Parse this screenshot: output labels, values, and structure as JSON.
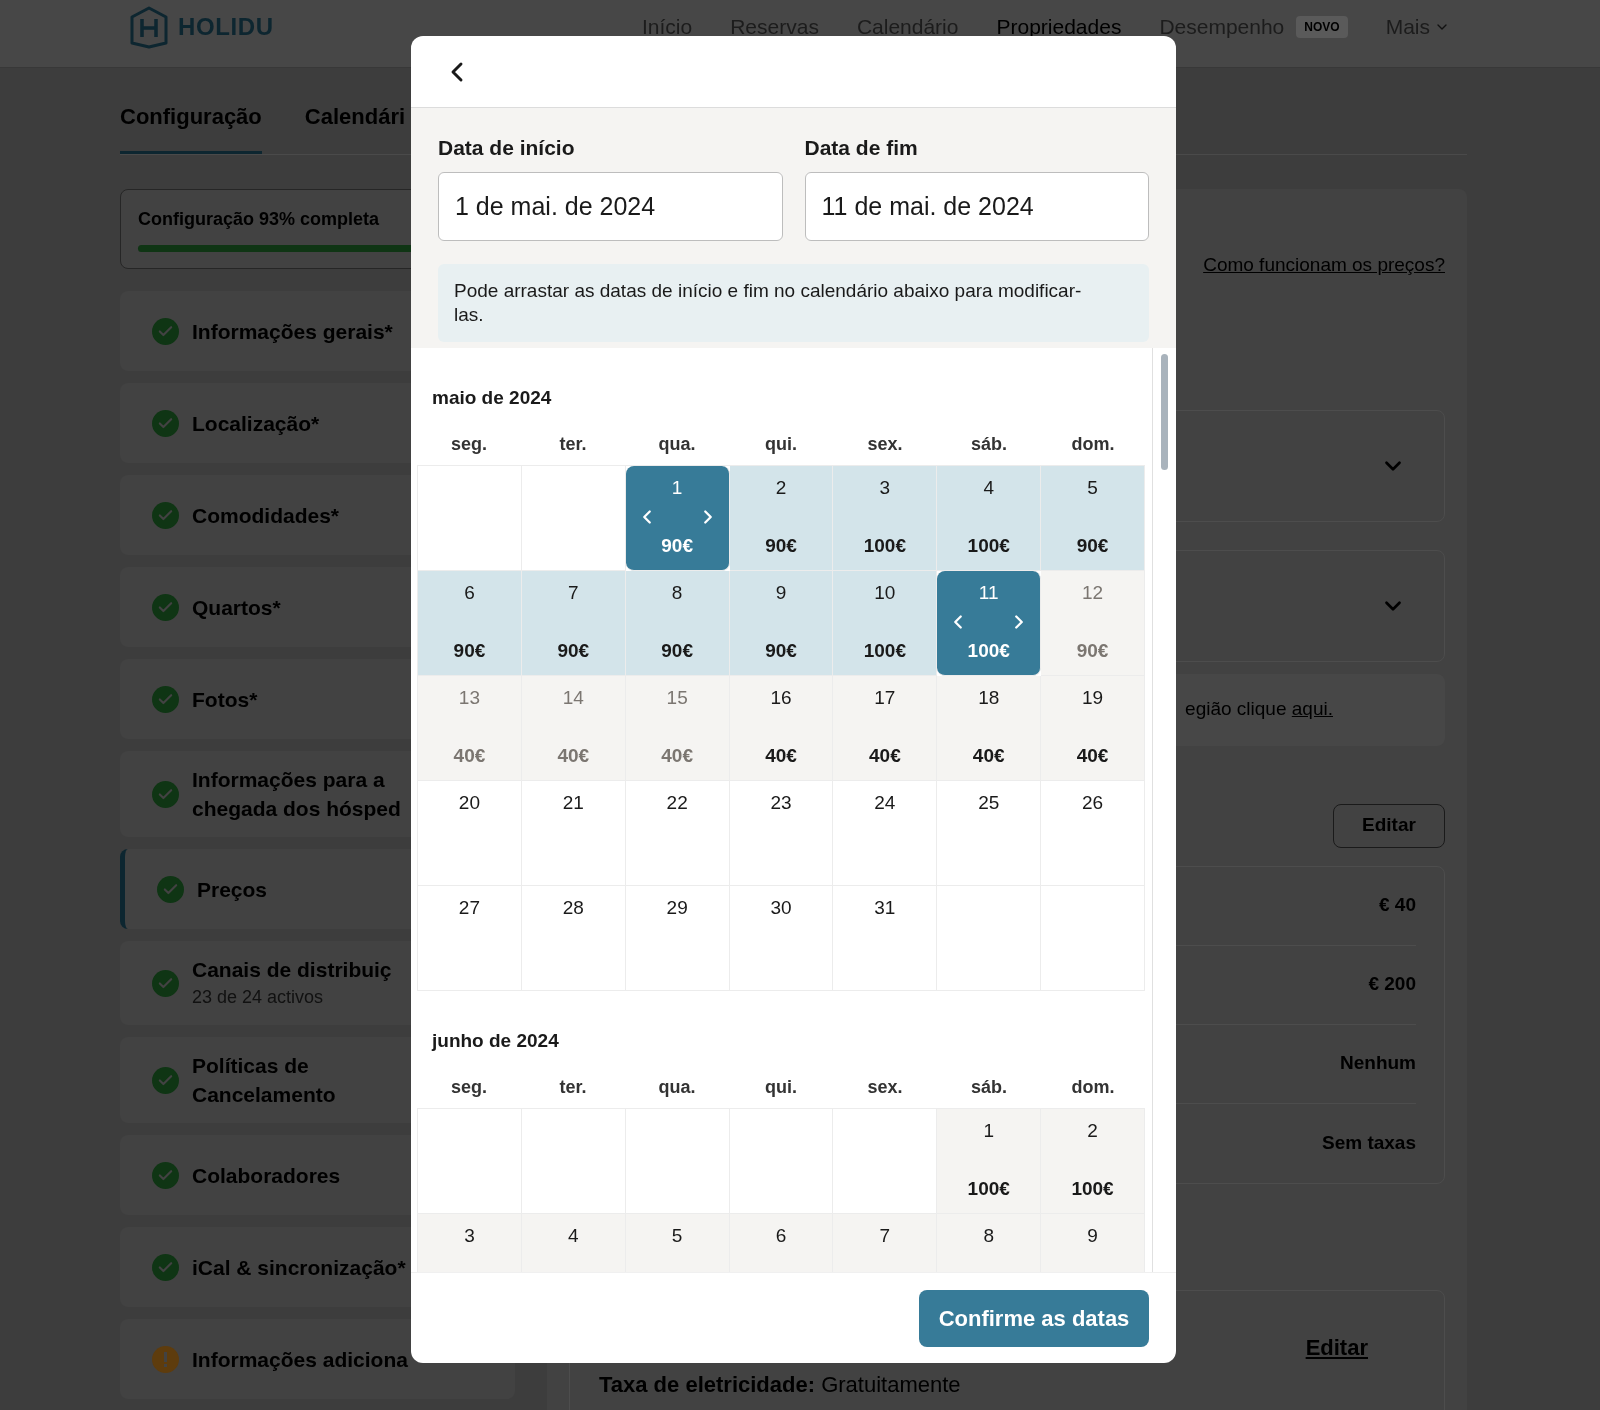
{
  "header": {
    "logo": "HOLIDU",
    "nav": [
      {
        "label": "Início",
        "selected": false
      },
      {
        "label": "Reservas",
        "selected": false
      },
      {
        "label": "Calendário",
        "selected": false
      },
      {
        "label": "Propriedades",
        "selected": true
      },
      {
        "label": "Desempenho",
        "selected": false,
        "badge": "NOVO"
      },
      {
        "label": "Mais",
        "selected": false,
        "menu": true
      }
    ]
  },
  "tabs": [
    {
      "label": "Configuração",
      "selected": true
    },
    {
      "label": "Calendári",
      "selected": false
    }
  ],
  "sidebar": {
    "progress": {
      "label": "Configuração 93% completa",
      "level": 0.93
    },
    "items": [
      {
        "label": "Informações gerais*",
        "kind": "done",
        "selected": false
      },
      {
        "label": "Localização*",
        "kind": "done",
        "selected": false
      },
      {
        "label": "Comodidades*",
        "kind": "done",
        "selected": false
      },
      {
        "label": "Quartos*",
        "kind": "done",
        "selected": false
      },
      {
        "label": "Fotos*",
        "kind": "done",
        "selected": false
      },
      {
        "label": "Informações para a chegada dos hósped",
        "kind": "done",
        "selected": false
      },
      {
        "label": "Preços",
        "kind": "done",
        "selected": true
      },
      {
        "label": "Canais de distribuiç",
        "sub": "23 de 24 activos",
        "kind": "done",
        "selected": false
      },
      {
        "label": "Políticas de Cancelamento",
        "kind": "done",
        "selected": false
      },
      {
        "label": "Colaboradores",
        "kind": "done",
        "selected": false
      },
      {
        "label": "iCal & sincronização*",
        "kind": "done",
        "selected": false
      },
      {
        "label": "Informações adiciona",
        "kind": "warning",
        "selected": false
      }
    ]
  },
  "main": {
    "help_link": "Como funcionam os preços?",
    "accordions": [
      {
        "expanded": false
      },
      {
        "expanded": false
      }
    ],
    "note": {
      "text": "egião clique ",
      "link": "aqui."
    },
    "edit_button": "Editar",
    "summary_rows": [
      "€ 40",
      "€ 200",
      "Nenhum",
      "Sem taxas"
    ],
    "fees_card": {
      "edit_link": "Editar",
      "label": "Taxa de eletricidade:",
      "value": "Gratuitamente"
    }
  },
  "modal": {
    "start": {
      "label": "Data de início",
      "value": "1 de mai. de 2024"
    },
    "end": {
      "label": "Data de fim",
      "value": "11 de mai. de 2024"
    },
    "hint": "Pode arrastar as datas de início e fim no calendário abaixo para modificar-las.",
    "calendar": {
      "months": [
        {
          "title": "maio de 2024",
          "weekdays": [
            "seg.",
            "ter.",
            "qua.",
            "qui.",
            "sex.",
            "sáb.",
            "dom."
          ],
          "days": [
            {
              "kind": "empty"
            },
            {
              "kind": "empty"
            },
            {
              "kind": "endpoint",
              "day": "1",
              "price": "90€",
              "muted": false
            },
            {
              "kind": "range",
              "day": "2",
              "price": "90€",
              "muted": false
            },
            {
              "kind": "range",
              "day": "3",
              "price": "100€",
              "muted": false
            },
            {
              "kind": "range",
              "day": "4",
              "price": "100€",
              "muted": false
            },
            {
              "kind": "range",
              "day": "5",
              "price": "90€",
              "muted": false
            },
            {
              "kind": "range",
              "day": "6",
              "price": "90€",
              "muted": false
            },
            {
              "kind": "range",
              "day": "7",
              "price": "90€",
              "muted": false
            },
            {
              "kind": "range",
              "day": "8",
              "price": "90€",
              "muted": false
            },
            {
              "kind": "range",
              "day": "9",
              "price": "90€",
              "muted": false
            },
            {
              "kind": "range",
              "day": "10",
              "price": "100€",
              "muted": false
            },
            {
              "kind": "endpoint",
              "day": "11",
              "price": "100€",
              "muted": false
            },
            {
              "kind": "priced",
              "day": "12",
              "price": "90€",
              "muted": true
            },
            {
              "kind": "priced",
              "day": "13",
              "price": "40€",
              "muted": true
            },
            {
              "kind": "priced",
              "day": "14",
              "price": "40€",
              "muted": true
            },
            {
              "kind": "priced",
              "day": "15",
              "price": "40€",
              "muted": true
            },
            {
              "kind": "priced",
              "day": "16",
              "price": "40€",
              "muted": false
            },
            {
              "kind": "priced",
              "day": "17",
              "price": "40€",
              "muted": false
            },
            {
              "kind": "priced",
              "day": "18",
              "price": "40€",
              "muted": false
            },
            {
              "kind": "priced",
              "day": "19",
              "price": "40€",
              "muted": false
            },
            {
              "kind": "plain",
              "day": "20",
              "muted": false
            },
            {
              "kind": "plain",
              "day": "21",
              "muted": false
            },
            {
              "kind": "plain",
              "day": "22",
              "muted": false
            },
            {
              "kind": "plain",
              "day": "23",
              "muted": false
            },
            {
              "kind": "plain",
              "day": "24",
              "muted": false
            },
            {
              "kind": "plain",
              "day": "25",
              "muted": false
            },
            {
              "kind": "plain",
              "day": "26",
              "muted": false
            },
            {
              "kind": "plain",
              "day": "27",
              "muted": false
            },
            {
              "kind": "plain",
              "day": "28",
              "muted": false
            },
            {
              "kind": "plain",
              "day": "29",
              "muted": false
            },
            {
              "kind": "plain",
              "day": "30",
              "muted": false
            },
            {
              "kind": "plain",
              "day": "31",
              "muted": false
            },
            {
              "kind": "empty"
            },
            {
              "kind": "empty"
            }
          ]
        },
        {
          "title": "junho de 2024",
          "weekdays": [
            "seg.",
            "ter.",
            "qua.",
            "qui.",
            "sex.",
            "sáb.",
            "dom."
          ],
          "days": [
            {
              "kind": "empty"
            },
            {
              "kind": "empty"
            },
            {
              "kind": "empty"
            },
            {
              "kind": "empty"
            },
            {
              "kind": "empty"
            },
            {
              "kind": "priced",
              "day": "1",
              "price": "100€",
              "muted": false
            },
            {
              "kind": "priced",
              "day": "2",
              "price": "100€",
              "muted": false
            },
            {
              "kind": "priced",
              "day": "3",
              "muted": false
            },
            {
              "kind": "priced",
              "day": "4",
              "muted": false
            },
            {
              "kind": "priced",
              "day": "5",
              "muted": false
            },
            {
              "kind": "priced",
              "day": "6",
              "muted": false
            },
            {
              "kind": "priced",
              "day": "7",
              "muted": false
            },
            {
              "kind": "priced",
              "day": "8",
              "muted": false
            },
            {
              "kind": "priced",
              "day": "9",
              "muted": false
            }
          ]
        }
      ]
    },
    "confirm_button": "Confirme as datas"
  }
}
